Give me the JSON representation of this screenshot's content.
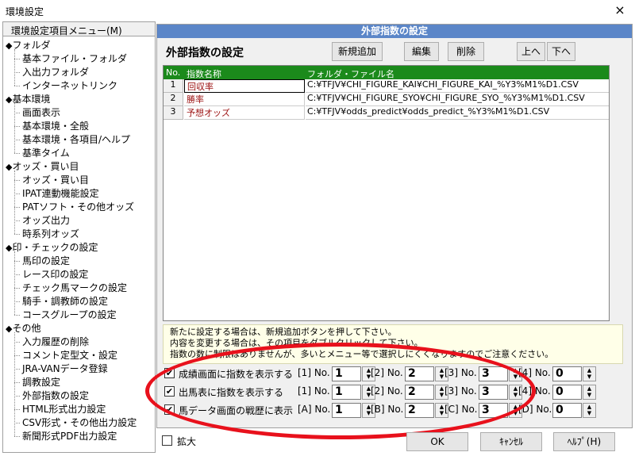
{
  "window": {
    "title": "環境設定",
    "close_glyph": "×"
  },
  "menu": {
    "header": "環境設定項目メニュー(M)",
    "items": [
      {
        "label": "フォルダ",
        "level": 0
      },
      {
        "label": "基本ファイル・フォルダ",
        "level": 1
      },
      {
        "label": "入出力フォルダ",
        "level": 1
      },
      {
        "label": "インターネットリンク",
        "level": 1
      },
      {
        "label": "基本環境",
        "level": 0
      },
      {
        "label": "画面表示",
        "level": 1
      },
      {
        "label": "基本環境・全般",
        "level": 1
      },
      {
        "label": "基本環境・各項目/ヘルプ",
        "level": 1
      },
      {
        "label": "基準タイム",
        "level": 1
      },
      {
        "label": "オッズ・買い目",
        "level": 0
      },
      {
        "label": "オッズ・買い目",
        "level": 1
      },
      {
        "label": "IPAT連動機能設定",
        "level": 1
      },
      {
        "label": "PATソフト・その他オッズ",
        "level": 1
      },
      {
        "label": "オッズ出力",
        "level": 1
      },
      {
        "label": "時系列オッズ",
        "level": 1
      },
      {
        "label": "印・チェックの設定",
        "level": 0
      },
      {
        "label": "馬印の設定",
        "level": 1
      },
      {
        "label": "レース印の設定",
        "level": 1
      },
      {
        "label": "チェック馬マークの設定",
        "level": 1
      },
      {
        "label": "騎手・調教師の設定",
        "level": 1
      },
      {
        "label": "コースグループの設定",
        "level": 1
      },
      {
        "label": "その他",
        "level": 0
      },
      {
        "label": "入力履歴の削除",
        "level": 1
      },
      {
        "label": "コメント定型文・設定",
        "level": 1
      },
      {
        "label": "JRA-VANデータ登録",
        "level": 1
      },
      {
        "label": "調教設定",
        "level": 1
      },
      {
        "label": "外部指数の設定",
        "level": 1
      },
      {
        "label": "HTML形式出力設定",
        "level": 1
      },
      {
        "label": "CSV形式・その他出力設定",
        "level": 1
      },
      {
        "label": "新聞形式PDF出力設定",
        "level": 1
      }
    ]
  },
  "panel": {
    "bar_title": "外部指数の設定",
    "title": "外部指数の設定",
    "buttons": {
      "add": "新規追加",
      "edit": "編集",
      "delete": "削除",
      "up": "上へ",
      "down": "下へ"
    },
    "grid": {
      "columns": [
        "No.",
        "指数名称",
        "フォルダ・ファイル名"
      ],
      "rows": [
        {
          "no": "1",
          "name": "回収率",
          "path": "C:¥TFJV¥CHI_FIGURE_KAI¥CHI_FIGURE_KAI_%Y3%M1%D1.CSV"
        },
        {
          "no": "2",
          "name": "勝率",
          "path": "C:¥TFJV¥CHI_FIGURE_SYO¥CHI_FIGURE_SYO_%Y3%M1%D1.CSV"
        },
        {
          "no": "3",
          "name": "予想オッズ",
          "path": "C:¥TFJV¥odds_predict¥odds_predict_%Y3%M1%D1.CSV"
        }
      ]
    },
    "info_lines": [
      "新たに設定する場合は、新規追加ボタンを押して下さい。",
      "内容を変更する場合は、その項目をダブルクリックして下さい。",
      "指数の数に制限はありませんが、多いとメニュー等で選択しにくくなりますのでご注意ください。"
    ],
    "options": [
      {
        "checked": true,
        "label": "成績画面に指数を表示する",
        "slots": [
          {
            "lbl": "[1] No.",
            "val": "1"
          },
          {
            "lbl": "[2] No.",
            "val": "2"
          },
          {
            "lbl": "[3] No.",
            "val": "3"
          },
          {
            "lbl": "[4] No.",
            "val": "0"
          }
        ]
      },
      {
        "checked": true,
        "label": "出馬表に指数を表示する",
        "slots": [
          {
            "lbl": "[1] No.",
            "val": "1"
          },
          {
            "lbl": "[2] No.",
            "val": "2"
          },
          {
            "lbl": "[3] No.",
            "val": "3"
          },
          {
            "lbl": "[4] No.",
            "val": "0"
          }
        ]
      },
      {
        "checked": true,
        "label": "馬データ画面の戦歴に表示",
        "slots": [
          {
            "lbl": "[A] No.",
            "val": "1"
          },
          {
            "lbl": "[B] No.",
            "val": "2"
          },
          {
            "lbl": "[C] No.",
            "val": "3"
          },
          {
            "lbl": "[D] No.",
            "val": "0"
          }
        ]
      }
    ]
  },
  "footer": {
    "zoom_label": "拡大",
    "ok": "OK",
    "cancel": "ｷｬﾝｾﾙ",
    "help": "ﾍﾙﾌﾟ(H)"
  },
  "colors": {
    "panel_bar": "#5b86c8",
    "grid_header": "#1b8a1b",
    "highlight": "#e8111c"
  }
}
